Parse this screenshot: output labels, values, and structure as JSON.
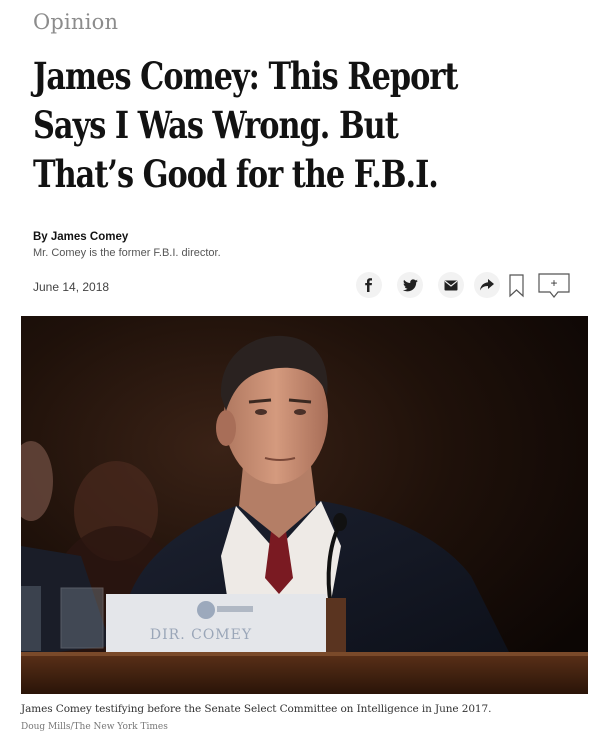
{
  "article": {
    "section": "Opinion",
    "headline": "James Comey: This Report Says I Was Wrong. But That’s Good for the F.B.I.",
    "byline": "By James Comey",
    "bio": "Mr. Comey is the former F.B.I. director.",
    "date": "June 14, 2018"
  },
  "share": {
    "icons": [
      "facebook-icon",
      "twitter-icon",
      "email-icon",
      "share-icon",
      "bookmark-icon",
      "comment-icon"
    ],
    "comment_symbol": "+"
  },
  "photo": {
    "nameplate_text": "DIR. COMEY",
    "caption": "James Comey testifying before the Senate Select Committee on Intelligence in June 2017.",
    "credit": "Doug Mills/The New York Times"
  }
}
